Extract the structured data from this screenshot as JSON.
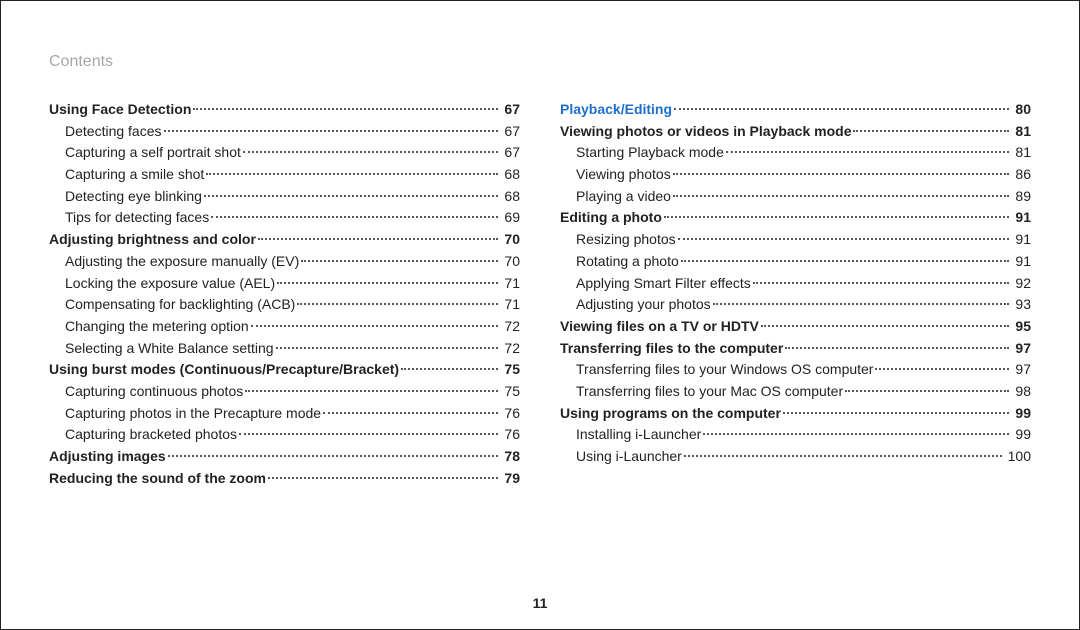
{
  "header": "Contents",
  "page_number": "11",
  "left": [
    {
      "level": 1,
      "title": "Using Face Detection",
      "page": "67"
    },
    {
      "level": 2,
      "title": "Detecting faces",
      "page": "67"
    },
    {
      "level": 2,
      "title": "Capturing a self portrait shot",
      "page": "67"
    },
    {
      "level": 2,
      "title": "Capturing a smile shot",
      "page": "68"
    },
    {
      "level": 2,
      "title": "Detecting eye blinking",
      "page": "68"
    },
    {
      "level": 2,
      "title": "Tips for detecting faces",
      "page": "69"
    },
    {
      "level": 1,
      "title": "Adjusting brightness and color",
      "page": "70"
    },
    {
      "level": 2,
      "title": "Adjusting the exposure manually (EV)",
      "page": "70"
    },
    {
      "level": 2,
      "title": "Locking the exposure value (AEL)",
      "page": "71"
    },
    {
      "level": 2,
      "title": "Compensating for backlighting (ACB)",
      "page": "71"
    },
    {
      "level": 2,
      "title": "Changing the metering option",
      "page": "72"
    },
    {
      "level": 2,
      "title": "Selecting a White Balance setting",
      "page": "72"
    },
    {
      "level": 1,
      "title": "Using burst modes (Continuous/Precapture/Bracket)",
      "page": "75"
    },
    {
      "level": 2,
      "title": "Capturing continuous photos",
      "page": "75"
    },
    {
      "level": 2,
      "title": "Capturing photos in the Precapture mode",
      "page": "76"
    },
    {
      "level": 2,
      "title": "Capturing bracketed photos",
      "page": "76"
    },
    {
      "level": 1,
      "title": "Adjusting images",
      "page": "78"
    },
    {
      "level": 1,
      "title": "Reducing the sound of the zoom",
      "page": "79"
    }
  ],
  "right": [
    {
      "level": "section",
      "title": "Playback/Editing",
      "page": "80"
    },
    {
      "level": 1,
      "title": "Viewing photos or videos in Playback mode",
      "page": "81"
    },
    {
      "level": 2,
      "title": "Starting Playback mode",
      "page": "81"
    },
    {
      "level": 2,
      "title": "Viewing photos",
      "page": "86"
    },
    {
      "level": 2,
      "title": "Playing a video",
      "page": "89"
    },
    {
      "level": 1,
      "title": "Editing a photo",
      "page": "91"
    },
    {
      "level": 2,
      "title": "Resizing photos",
      "page": "91"
    },
    {
      "level": 2,
      "title": "Rotating a photo",
      "page": "91"
    },
    {
      "level": 2,
      "title": "Applying Smart Filter effects",
      "page": "92"
    },
    {
      "level": 2,
      "title": "Adjusting your photos",
      "page": "93"
    },
    {
      "level": 1,
      "title": "Viewing files on a TV or HDTV",
      "page": "95"
    },
    {
      "level": 1,
      "title": "Transferring files to the computer",
      "page": "97"
    },
    {
      "level": 2,
      "title": "Transferring files to your Windows OS computer",
      "page": "97"
    },
    {
      "level": 2,
      "title": "Transferring files to your Mac OS computer",
      "page": "98"
    },
    {
      "level": 1,
      "title": "Using programs on the computer",
      "page": "99"
    },
    {
      "level": 2,
      "title": "Installing i-Launcher",
      "page": "99"
    },
    {
      "level": 2,
      "title": "Using i-Launcher",
      "page": "100"
    }
  ]
}
